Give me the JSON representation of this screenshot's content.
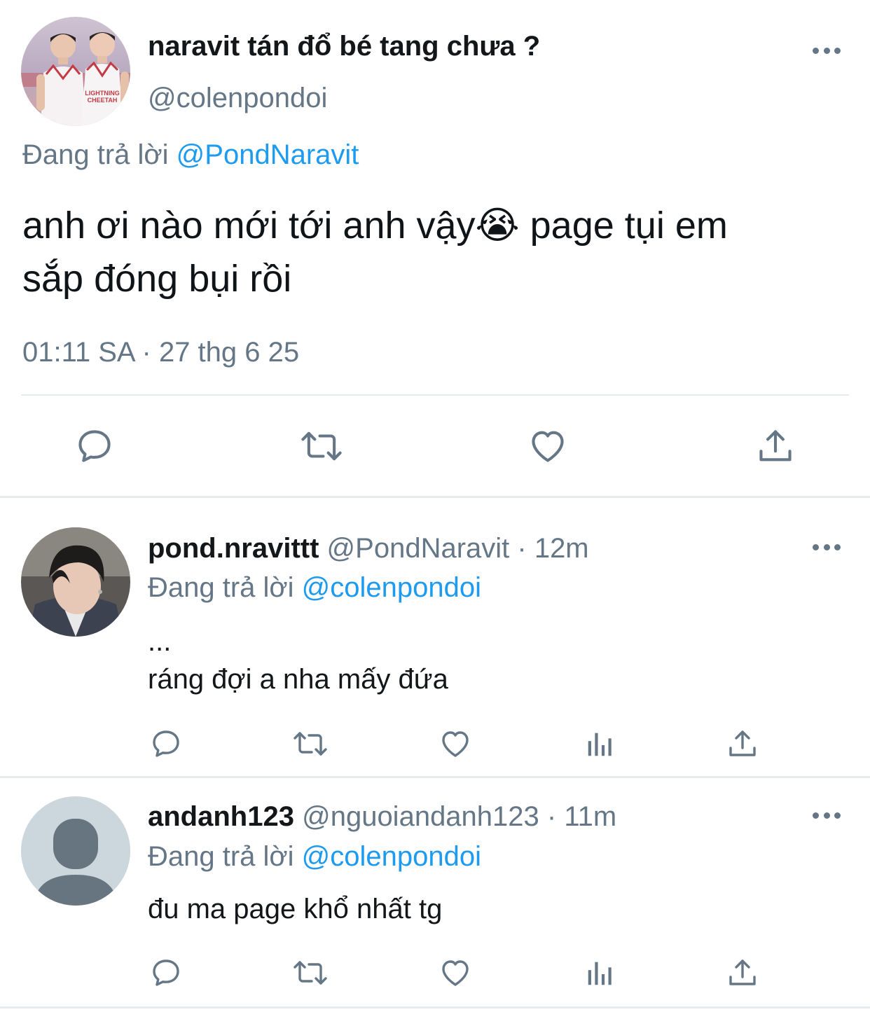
{
  "main_tweet": {
    "display_name": "naravit tán đổ bé tang chưa ?",
    "handle": "@colenpondoi",
    "replying_prefix": "Đang trả lời",
    "replying_to": "@PondNaravit",
    "text_line1": "anh ơi nào mới tới anh vậy😭 page tụi em",
    "text_line2": "sắp đóng bụi rồi",
    "timestamp": "01:11 SA · 27 thg 6 25",
    "actions": [
      "comment-icon",
      "retweet-icon",
      "heart-icon",
      "share-icon"
    ]
  },
  "replies": [
    {
      "display_name": "pond.nravittt",
      "handle_time": "@PondNaravit · 12m",
      "replying_prefix": "Đang trả lời",
      "replying_to": "@colenpondoi",
      "text_line1": "...",
      "text_line2": "ráng đợi a nha mấy đứa",
      "actions": [
        "comment-icon",
        "retweet-icon",
        "heart-icon",
        "stats-icon",
        "share-icon"
      ]
    },
    {
      "display_name": "andanh123",
      "handle_time": "@nguoiandanh123 · 11m",
      "replying_prefix": "Đang trả lời",
      "replying_to": "@colenpondoi",
      "text_line1": "đu ma page khổ nhất tg",
      "actions": [
        "comment-icon",
        "retweet-icon",
        "heart-icon",
        "stats-icon",
        "share-icon"
      ]
    }
  ],
  "colors": {
    "link": "#1d9bf0",
    "muted": "#657786",
    "divider": "#e7eaee",
    "default_avatar_bg": "#ccd6dd",
    "default_avatar_fg": "#66757f"
  }
}
